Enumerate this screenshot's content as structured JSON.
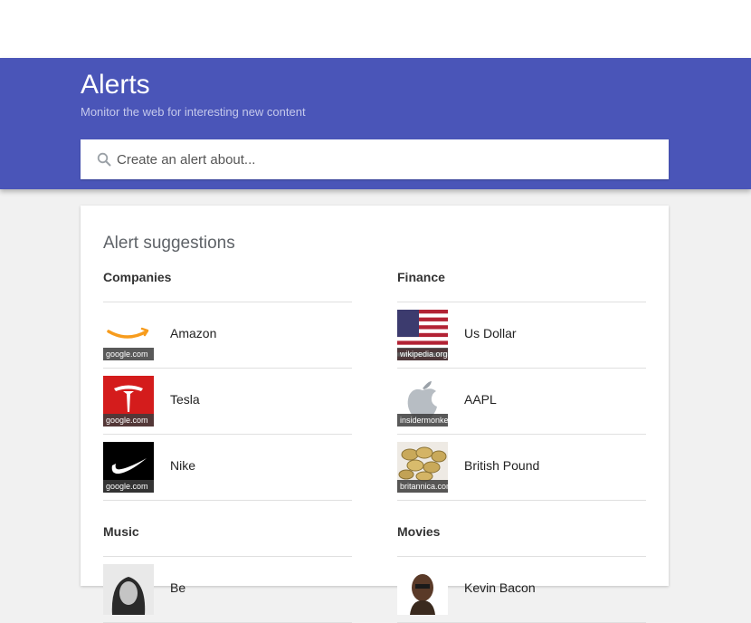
{
  "header": {
    "title": "Alerts",
    "subtitle": "Monitor the web for interesting new content",
    "search_placeholder": "Create an alert about..."
  },
  "suggestions": {
    "title": "Alert suggestions",
    "companies": {
      "header": "Companies",
      "items": [
        {
          "label": "Amazon",
          "source": "google.com",
          "icon": "amazon-logo-icon"
        },
        {
          "label": "Tesla",
          "source": "google.com",
          "icon": "tesla-logo-icon"
        },
        {
          "label": "Nike",
          "source": "google.com",
          "icon": "nike-logo-icon"
        }
      ]
    },
    "finance": {
      "header": "Finance",
      "items": [
        {
          "label": "Us Dollar",
          "source": "wikipedia.org",
          "icon": "us-flag-icon"
        },
        {
          "label": "AAPL",
          "source": "insidermonkey",
          "icon": "apple-logo-icon"
        },
        {
          "label": "British Pound",
          "source": "britannica.com",
          "icon": "coins-icon"
        }
      ]
    },
    "music": {
      "header": "Music",
      "items": [
        {
          "label": "Be",
          "icon": "person-photo-icon"
        }
      ]
    },
    "movies": {
      "header": "Movies",
      "items": [
        {
          "label": "Kevin Bacon",
          "icon": "person-photo-icon"
        }
      ]
    }
  },
  "colors": {
    "header_bg": "#4a55b8",
    "page_bg": "#f1f1f1"
  }
}
